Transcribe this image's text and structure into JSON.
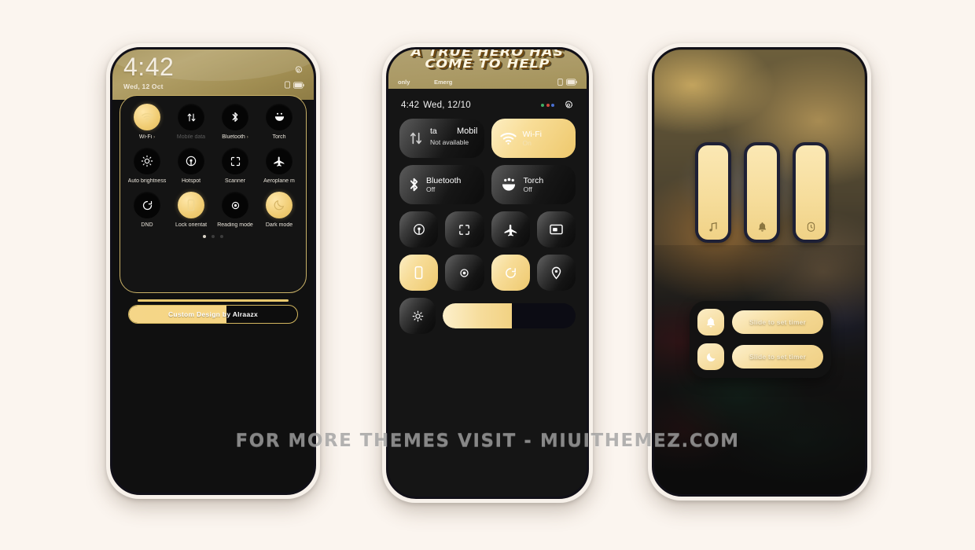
{
  "watermark": "FOR MORE THEMES VISIT - MIUITHEMEZ.COM",
  "colors": {
    "gold": "#f0cd73",
    "gold_light": "#fbe8b4",
    "header_gold": "#a8965e",
    "panel_dark": "#141414",
    "page_bg": "#fbf5ef"
  },
  "phone1": {
    "status": {
      "time": "4:42",
      "date": "Wed, 12 Oct"
    },
    "tiles": [
      {
        "label": "Wi-Fi",
        "icon": "wifi-icon",
        "state": "on",
        "caret": "›"
      },
      {
        "label": "Mobile data",
        "icon": "mobile-data-icon",
        "state": "disabled",
        "caret": ""
      },
      {
        "label": "Bluetooth",
        "icon": "bluetooth-icon",
        "state": "off",
        "caret": "›"
      },
      {
        "label": "Torch",
        "icon": "torch-icon",
        "state": "off",
        "caret": ""
      },
      {
        "label": "Auto brightness",
        "icon": "brightness-icon",
        "state": "off",
        "caret": ""
      },
      {
        "label": "Hotspot",
        "icon": "hotspot-icon",
        "state": "off",
        "caret": ""
      },
      {
        "label": "Scanner",
        "icon": "scanner-icon",
        "state": "off",
        "caret": ""
      },
      {
        "label": "Aeroplane m",
        "icon": "aeroplane-icon",
        "state": "off",
        "caret": ""
      },
      {
        "label": "DND",
        "icon": "dnd-icon",
        "state": "off",
        "caret": ""
      },
      {
        "label": "Lock orientat",
        "icon": "lock-rotation-icon",
        "state": "on",
        "caret": ""
      },
      {
        "label": "Reading mode",
        "icon": "reading-mode-icon",
        "state": "off",
        "caret": ""
      },
      {
        "label": "Dark mode",
        "icon": "dark-mode-icon",
        "state": "on",
        "caret": ""
      }
    ],
    "pager": {
      "count": 3,
      "active": 0
    },
    "brightness": {
      "text": "Custom Design by Alraazx",
      "fill_percent": 58
    }
  },
  "phone2": {
    "wallpaper_text": {
      "line1": "A TRUE HERO HAS",
      "line2": "COME TO HELP"
    },
    "status": {
      "left1": "only",
      "left2": "Emerg"
    },
    "header": {
      "time": "4:42",
      "date": "Wed, 12/10"
    },
    "big_tiles": [
      {
        "title": "Mobile data",
        "overlap_a": "ta",
        "overlap_b": "Mobil",
        "sub": "Not available",
        "icon": "mobile-data-icon",
        "state": "off"
      },
      {
        "title": "Wi-Fi",
        "sub": "On",
        "icon": "wifi-icon",
        "state": "on"
      },
      {
        "title": "Bluetooth",
        "sub": "Off",
        "icon": "bluetooth-icon",
        "state": "off"
      },
      {
        "title": "Torch",
        "sub": "Off",
        "icon": "torch-icon",
        "state": "off"
      }
    ],
    "small_tiles": [
      {
        "icon": "hotspot-icon",
        "state": "off"
      },
      {
        "icon": "scanner-icon",
        "state": "off"
      },
      {
        "icon": "aeroplane-icon",
        "state": "off"
      },
      {
        "icon": "cast-icon",
        "state": "off"
      },
      {
        "icon": "lock-rotation-icon",
        "state": "on"
      },
      {
        "icon": "reading-mode-icon",
        "state": "off"
      },
      {
        "icon": "dnd-icon",
        "state": "on"
      },
      {
        "icon": "location-icon",
        "state": "off"
      }
    ],
    "brightness": {
      "icon": "brightness-icon",
      "fill_percent": 52
    }
  },
  "phone3": {
    "volume_sliders": [
      {
        "icon": "media-icon",
        "level_percent": 100
      },
      {
        "icon": "ring-icon",
        "level_percent": 100
      },
      {
        "icon": "alarm-icon",
        "level_percent": 100
      }
    ],
    "timers": [
      {
        "icon": "bell-icon",
        "label": "Slide to set timer"
      },
      {
        "icon": "moon-icon",
        "label": "Slide to set timer"
      }
    ]
  }
}
